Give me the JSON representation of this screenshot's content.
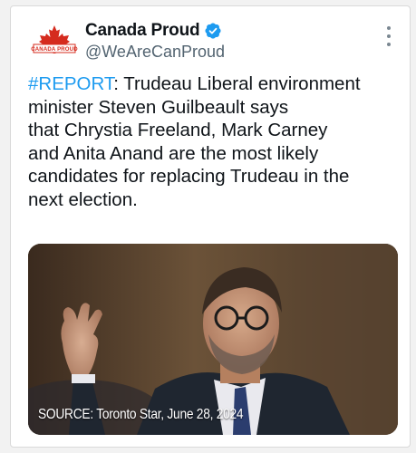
{
  "account": {
    "name": "Canada Proud",
    "handle": "@WeAreCanProud",
    "logo_text": "CANADA PROUD",
    "verified": true
  },
  "tweet": {
    "hashtag": "#REPORT",
    "lines": [
      ": Trudeau Liberal environment",
      "minister Steven Guilbeault says",
      "that Chrystia Freeland, Mark Carney",
      "and Anita Anand are the most likely",
      "candidates for replacing Trudeau in the",
      "next election."
    ]
  },
  "media": {
    "caption": "SOURCE: Toronto Star, June 28, 2024"
  },
  "icons": {
    "verified": "verified-badge-icon",
    "more": "more-options-icon"
  },
  "colors": {
    "hashtag": "#1d9bf0",
    "verified": "#1d9bf0",
    "logo_red": "#d52b1e",
    "handle": "#536471",
    "text": "#0f1419"
  }
}
